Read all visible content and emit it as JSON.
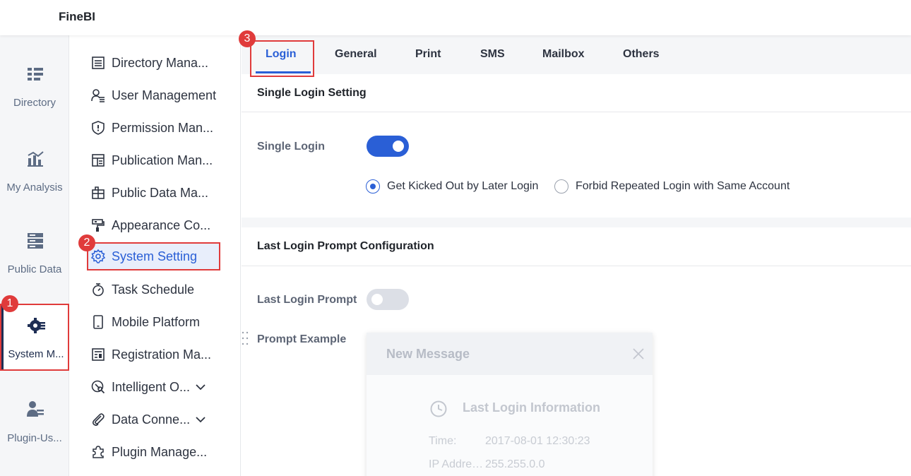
{
  "app": {
    "title": "FineBI"
  },
  "leftnav": {
    "items": [
      {
        "label": "Directory",
        "icon": "directory-icon"
      },
      {
        "label": "My Analysis",
        "icon": "analysis-chart-icon"
      },
      {
        "label": "Public Data",
        "icon": "database-icon"
      },
      {
        "label": "System M...",
        "icon": "system-gear-icon"
      },
      {
        "label": "Plugin-Us...",
        "icon": "plugin-user-icon"
      }
    ]
  },
  "submenu": {
    "items": [
      {
        "label": "Directory Mana...",
        "icon": "list-icon"
      },
      {
        "label": "User Management",
        "icon": "user-list-icon"
      },
      {
        "label": "Permission Man...",
        "icon": "shield-icon"
      },
      {
        "label": "Publication Man...",
        "icon": "publication-icon"
      },
      {
        "label": "Public Data Ma...",
        "icon": "toolbox-icon"
      },
      {
        "label": "Appearance Co...",
        "icon": "paint-roller-icon"
      },
      {
        "label": "System Setting",
        "icon": "gear-icon"
      },
      {
        "label": "Task Schedule",
        "icon": "stopwatch-icon"
      },
      {
        "label": "Mobile Platform",
        "icon": "phone-icon"
      },
      {
        "label": "Registration Ma...",
        "icon": "registration-icon"
      },
      {
        "label": "Intelligent O...",
        "icon": "intelligent-icon"
      },
      {
        "label": "Data Conne...",
        "icon": "paperclip-icon"
      },
      {
        "label": "Plugin Manage...",
        "icon": "puzzle-icon"
      }
    ]
  },
  "badges": {
    "one": "1",
    "two": "2",
    "three": "3"
  },
  "tabs": [
    "Login",
    "General",
    "Print",
    "SMS",
    "Mailbox",
    "Others"
  ],
  "single_login": {
    "section_title": "Single Login Setting",
    "label": "Single Login",
    "enabled": true,
    "options": [
      "Get Kicked Out by Later Login",
      "Forbid Repeated Login with Same Account"
    ],
    "selected": 0
  },
  "last_login": {
    "section_title": "Last Login Prompt Configuration",
    "label": "Last Login Prompt",
    "enabled": false,
    "example_label": "Prompt Example"
  },
  "preview": {
    "title": "New Message",
    "subtitle": "Last Login Information",
    "rows": [
      {
        "key": "Time:",
        "value": "2017-08-01 12:30:23"
      },
      {
        "key": "IP Address:",
        "value": "255.255.0.0"
      }
    ]
  },
  "colors": {
    "accent": "#2a5fd6",
    "highlight": "#e03b3b",
    "nav_bg": "#f5f6f8"
  }
}
